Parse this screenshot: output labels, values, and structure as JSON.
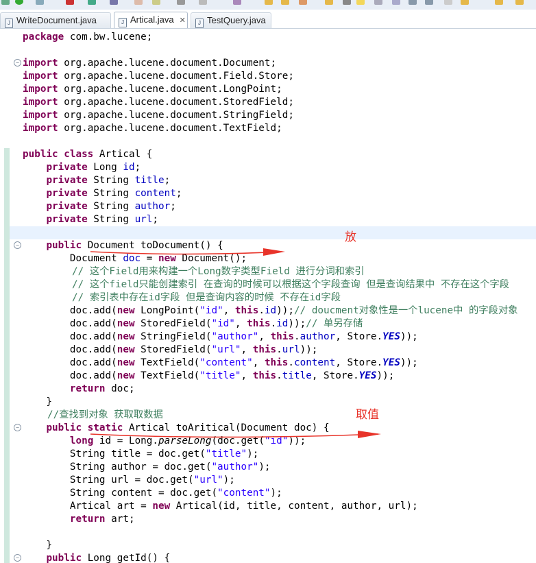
{
  "tabs": [
    {
      "label": "WriteDocument.java",
      "active": false
    },
    {
      "label": "Artical.java",
      "active": true,
      "close": "✕"
    },
    {
      "label": "TestQuery.java",
      "active": false
    }
  ],
  "annotations": {
    "put": "放",
    "get": "取值"
  },
  "code": {
    "l1": "com.bw.lucene;",
    "i1": "org.apache.lucene.document.Document;",
    "i2": "org.apache.lucene.document.Field.Store;",
    "i3": "org.apache.lucene.document.LongPoint;",
    "i4": "org.apache.lucene.document.StoredField;",
    "i5": "org.apache.lucene.document.StringField;",
    "i6": "org.apache.lucene.document.TextField;",
    "c1": "// 这个Field用来构建一个Long数字类型Field 进行分词和索引",
    "c2": "// 这个field只能创建索引 在查询的时候可以根据这个字段查询 但是查询结果中 不存在这个字段",
    "c3": "// 索引表中存在id字段 但是查询内容的时候 不存在id字段",
    "c4": "// doucment对象性是一个lucene中 的字段对象",
    "c5": "// 单另存储",
    "c6": "//查找到对象 获取取数据"
  },
  "colors": {
    "keyword": "#7f0055",
    "field": "#0000c0",
    "string": "#2a00ff",
    "comment": "#3f7f5f",
    "annotation": "#e8342a"
  }
}
